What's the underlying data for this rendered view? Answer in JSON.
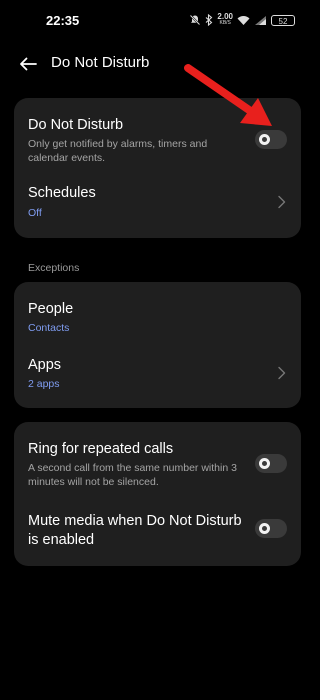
{
  "status_bar": {
    "time": "22:35",
    "net_speed": "2.00",
    "net_unit": "KB/S",
    "battery": "52"
  },
  "header": {
    "title": "Do Not Disturb"
  },
  "main_card": {
    "dnd": {
      "title": "Do Not Disturb",
      "description_line1": "Only get notified by alarms, timers and",
      "description_line2": "calendar events.",
      "enabled": false
    },
    "schedules": {
      "title": "Schedules",
      "value": "Off"
    }
  },
  "exceptions": {
    "section_label": "Exceptions",
    "people": {
      "title": "People",
      "value": "Contacts"
    },
    "apps": {
      "title": "Apps",
      "value": "2 apps"
    }
  },
  "extras": {
    "repeated_calls": {
      "title": "Ring for repeated calls",
      "description_line1": "A second call from the same number within 3",
      "description_line2": "minutes will not be silenced.",
      "enabled": false
    },
    "mute_media": {
      "title_line1": "Mute media when Do Not Disturb",
      "title_line2": "is enabled",
      "enabled": false
    }
  },
  "colors": {
    "background": "#000000",
    "card": "#1f1f1f",
    "accent_value": "#7f9cf0",
    "annotation_arrow": "#e8201d",
    "toggle_track_off": "#3a3a3a"
  },
  "icons": {
    "back": "back-arrow-icon",
    "chevron": "chevron-right-icon",
    "annotation": "red-arrow-annotation"
  }
}
